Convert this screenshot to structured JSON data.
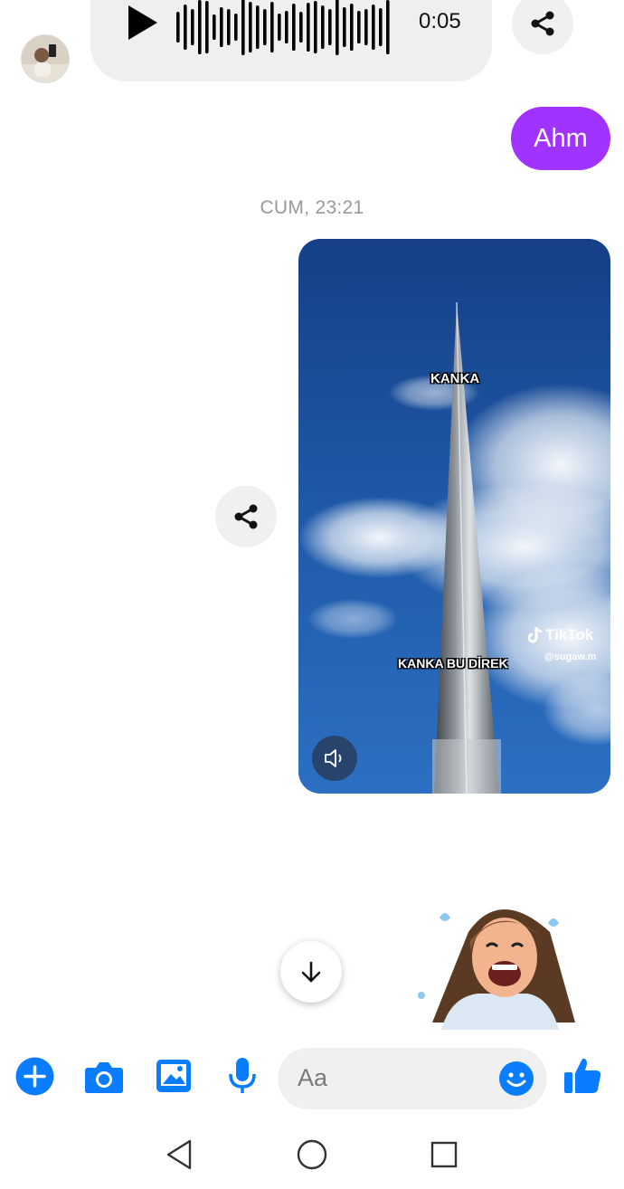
{
  "conversation": {
    "voice_message": {
      "duration": "0:05",
      "play_icon": "play-icon",
      "share_icon": "share-icon"
    },
    "sent_message": {
      "text": "Ahm"
    },
    "timestamp": "CUM, 23:21",
    "video_message": {
      "caption_top": "KANKA",
      "caption_bottom": "KANKA BU DİREK",
      "source_brand": "TikTok",
      "source_user": "@sugaw.m",
      "sound_icon": "speaker-icon",
      "share_icon": "share-icon"
    },
    "sticker": "laughing-avatar-sticker"
  },
  "scroll_down_icon": "arrow-down-icon",
  "composer": {
    "placeholder": "Aa",
    "icons": [
      "plus-icon",
      "camera-icon",
      "gallery-icon",
      "microphone-icon",
      "emoji-icon",
      "thumbs-up-icon"
    ]
  },
  "navigation": {
    "icons": [
      "back-triangle-icon",
      "home-circle-icon",
      "recents-square-icon"
    ]
  },
  "colors": {
    "accent": "#0a7cff",
    "sent_bubble": "#a033ff",
    "received_bubble": "#efefef"
  }
}
